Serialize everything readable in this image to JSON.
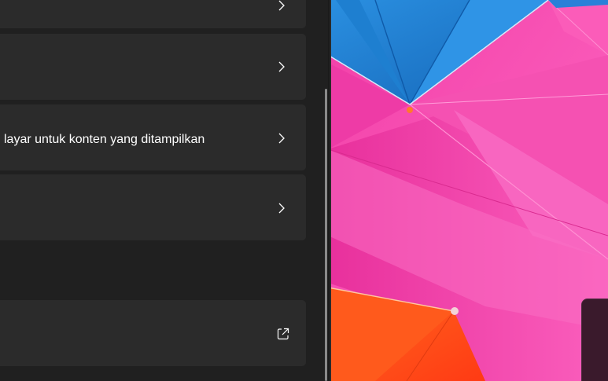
{
  "settings": {
    "cards": [
      {
        "label": "",
        "trailing_icon": "chevron-right-icon"
      },
      {
        "label": "",
        "trailing_icon": "chevron-right-icon"
      },
      {
        "label": "layar untuk konten yang ditampilkan",
        "trailing_icon": "chevron-right-icon"
      },
      {
        "label": "",
        "trailing_icon": "chevron-right-icon"
      },
      {
        "label": "",
        "trailing_icon": "open-external-icon"
      }
    ]
  },
  "colors": {
    "pane_background": "#202020",
    "card_background": "#2b2b2b",
    "text": "#ffffff",
    "umbrella_blue": "#1e7fd0",
    "umbrella_pink": "#f23fa8",
    "umbrella_orange": "#ff4d1a"
  },
  "wallpaper": {
    "subject": "umbrellas-wallpaper"
  }
}
